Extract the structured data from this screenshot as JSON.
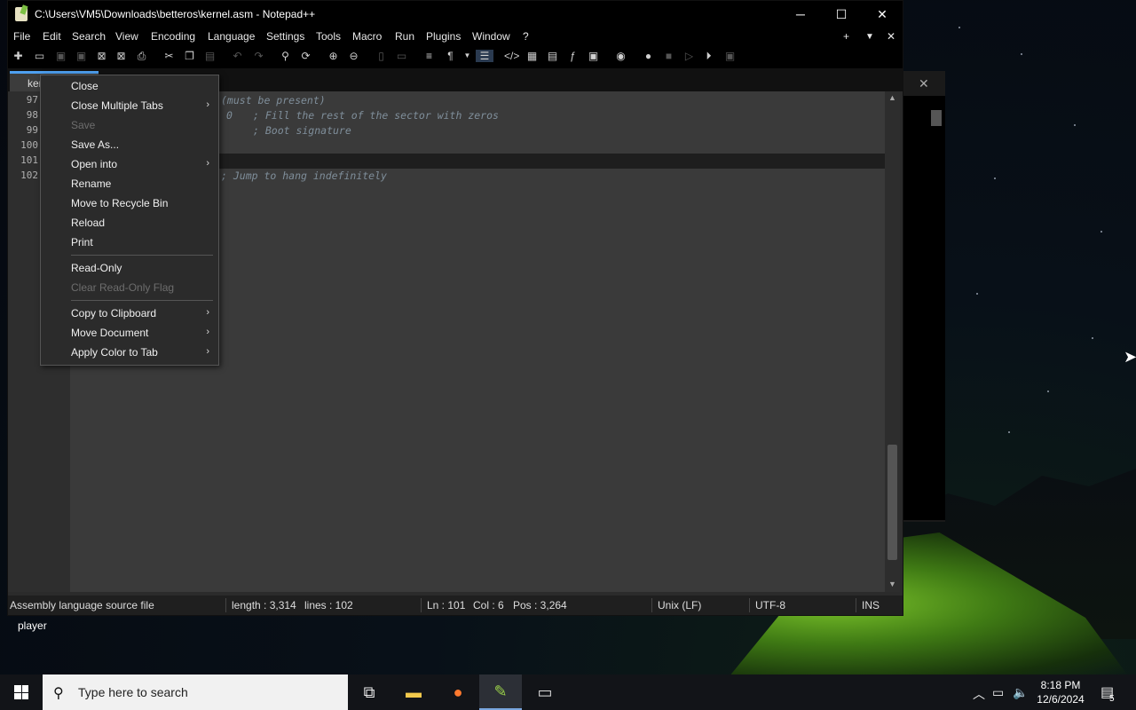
{
  "window": {
    "title": "C:\\Users\\VM5\\Downloads\\betteros\\kernel.asm - Notepad++",
    "minimize": "─",
    "maximize": "☐",
    "close": "✕"
  },
  "menubar": [
    "File",
    "Edit",
    "Search",
    "View",
    "Encoding",
    "Language",
    "Settings",
    "Tools",
    "Macro",
    "Run",
    "Plugins",
    "Window",
    "?"
  ],
  "menubar_right": {
    "plus": "+",
    "dropdown": "▼",
    "close": "✕"
  },
  "tab": {
    "label": "ker"
  },
  "line_numbers": [
    "97",
    "98",
    "99",
    "100",
    "101",
    "102"
  ],
  "code_lines": {
    "l97": "(must be present)",
    "l98_num": "0",
    "l98_comment": "; Fill the rest of the sector with zeros",
    "l99": "; Boot signature",
    "l102": "; Jump to hang indefinitely"
  },
  "context_menu": {
    "items": [
      {
        "label": "Close",
        "disabled": false,
        "submenu": false
      },
      {
        "label": "Close Multiple Tabs",
        "disabled": false,
        "submenu": true
      },
      {
        "label": "Save",
        "disabled": true,
        "submenu": false
      },
      {
        "label": "Save As...",
        "disabled": false,
        "submenu": false
      },
      {
        "label": "Open into",
        "disabled": false,
        "submenu": true
      },
      {
        "label": "Rename",
        "disabled": false,
        "submenu": false
      },
      {
        "label": "Move to Recycle Bin",
        "disabled": false,
        "submenu": false
      },
      {
        "label": "Reload",
        "disabled": false,
        "submenu": false
      },
      {
        "label": "Print",
        "disabled": false,
        "submenu": false
      },
      {
        "label": "Read-Only",
        "disabled": false,
        "submenu": false
      },
      {
        "label": "Clear Read-Only Flag",
        "disabled": true,
        "submenu": false
      },
      {
        "label": "Copy to Clipboard",
        "disabled": false,
        "submenu": true
      },
      {
        "label": "Move Document",
        "disabled": false,
        "submenu": true
      },
      {
        "label": "Apply Color to Tab",
        "disabled": false,
        "submenu": true
      }
    ],
    "arrow": "›"
  },
  "statusbar": {
    "filetype": "Assembly language source file",
    "length": "length : 3,314",
    "lines": "lines : 102",
    "ln": "Ln : 101",
    "col": "Col : 6",
    "pos": "Pos : 3,264",
    "eol": "Unix (LF)",
    "encoding": "UTF-8",
    "mode": "INS"
  },
  "desktop": {
    "label": "player"
  },
  "taskbar": {
    "search_placeholder": "Type here to search",
    "time": "8:18 PM",
    "date": "12/6/2024",
    "notification_count": "5"
  },
  "colors": {
    "tab_accent": "#4ea0f0",
    "tent_green": "#7ac22a"
  }
}
